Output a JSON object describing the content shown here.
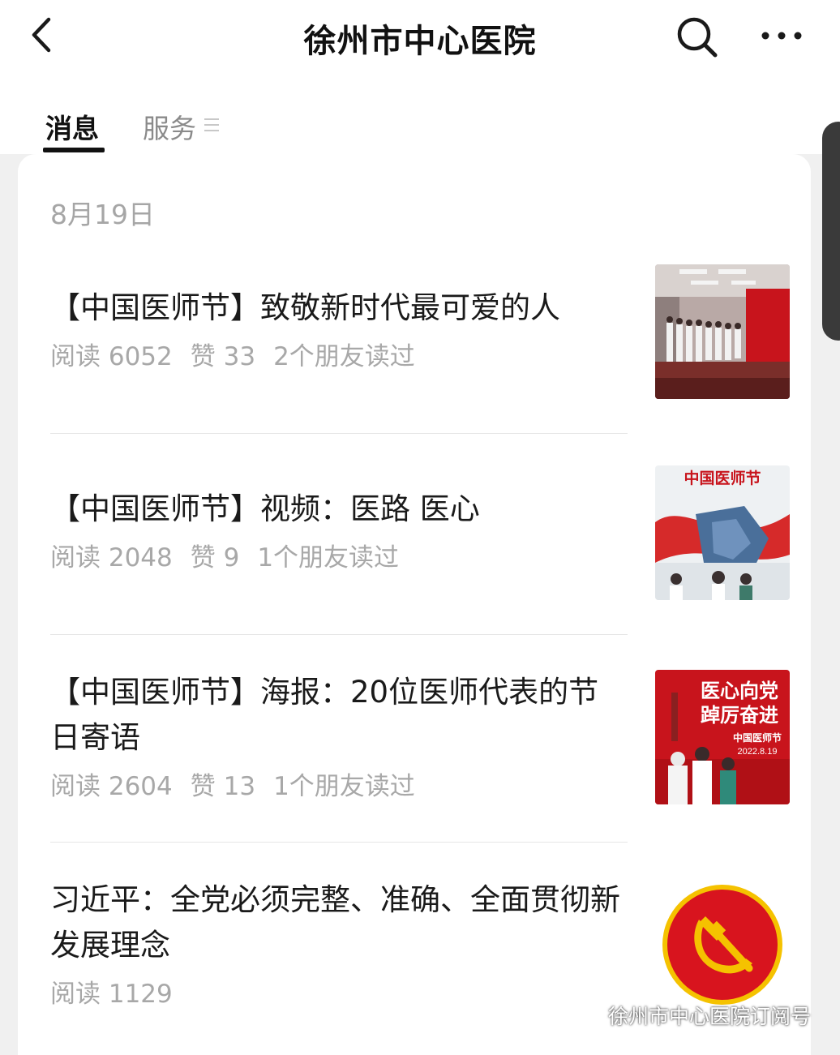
{
  "header": {
    "title": "徐州市中心医院"
  },
  "tabs": [
    {
      "label": "消息",
      "active": true
    },
    {
      "label": "服务",
      "active": false
    }
  ],
  "date": "8月19日",
  "articles": [
    {
      "title": "【中国医师节】致敬新时代最可爱的人",
      "reads": "阅读 6052",
      "likes": "赞 33",
      "friends": "2个朋友读过",
      "thumb": "hospital-hall-photo"
    },
    {
      "title": "【中国医师节】视频：医路 医心",
      "reads": "阅读 2048",
      "likes": "赞 9",
      "friends": "1个朋友读过",
      "thumb": "doctor-day-illustration"
    },
    {
      "title": "【中国医师节】海报：20位医师代表的节日寄语",
      "reads": "阅读 2604",
      "likes": "赞 13",
      "friends": "1个朋友读过",
      "thumb": "doctor-day-poster"
    },
    {
      "title": "习近平：全党必须完整、准确、全面贯彻新发展理念",
      "reads": "阅读 1129",
      "likes": "",
      "friends": "",
      "thumb": "party-emblem"
    }
  ],
  "thumb_texts": {
    "poster_line1": "医心向党",
    "poster_line2": "踔厉奋进",
    "poster_sub": "中国医师节",
    "poster_date": "2022.8.19",
    "illus_title": "中国医师节"
  },
  "watermark": "徐州市中心医院订阅号",
  "colors": {
    "accent_red": "#c8141c",
    "meta_gray": "#a8a8a8",
    "gold": "#f5c200"
  }
}
